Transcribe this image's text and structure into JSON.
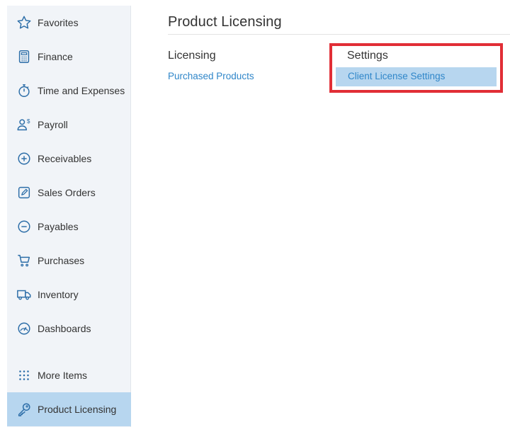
{
  "sidebar": {
    "items": [
      {
        "label": "Favorites",
        "icon": "star-icon"
      },
      {
        "label": "Finance",
        "icon": "calculator-icon"
      },
      {
        "label": "Time and Expenses",
        "icon": "stopwatch-icon"
      },
      {
        "label": "Payroll",
        "icon": "payroll-person-dollar-icon"
      },
      {
        "label": "Receivables",
        "icon": "plus-circle-icon"
      },
      {
        "label": "Sales Orders",
        "icon": "pencil-square-icon"
      },
      {
        "label": "Payables",
        "icon": "minus-circle-icon"
      },
      {
        "label": "Purchases",
        "icon": "cart-icon"
      },
      {
        "label": "Inventory",
        "icon": "truck-icon"
      },
      {
        "label": "Dashboards",
        "icon": "gauge-icon"
      },
      {
        "label": "More Items",
        "icon": "grid-dots-icon"
      },
      {
        "label": "Product Licensing",
        "icon": "key-icon"
      }
    ],
    "active": "Product Licensing"
  },
  "main": {
    "title": "Product Licensing",
    "columns": [
      {
        "heading": "Licensing",
        "links": [
          "Purchased Products"
        ]
      },
      {
        "heading": "Settings",
        "links": [
          "Client License Settings"
        ]
      }
    ]
  },
  "colors": {
    "accent_link": "#2f86c9",
    "active_bg": "#b7d6ef",
    "highlight_border": "#e12e36",
    "icon_blue": "#2d6ea8"
  }
}
